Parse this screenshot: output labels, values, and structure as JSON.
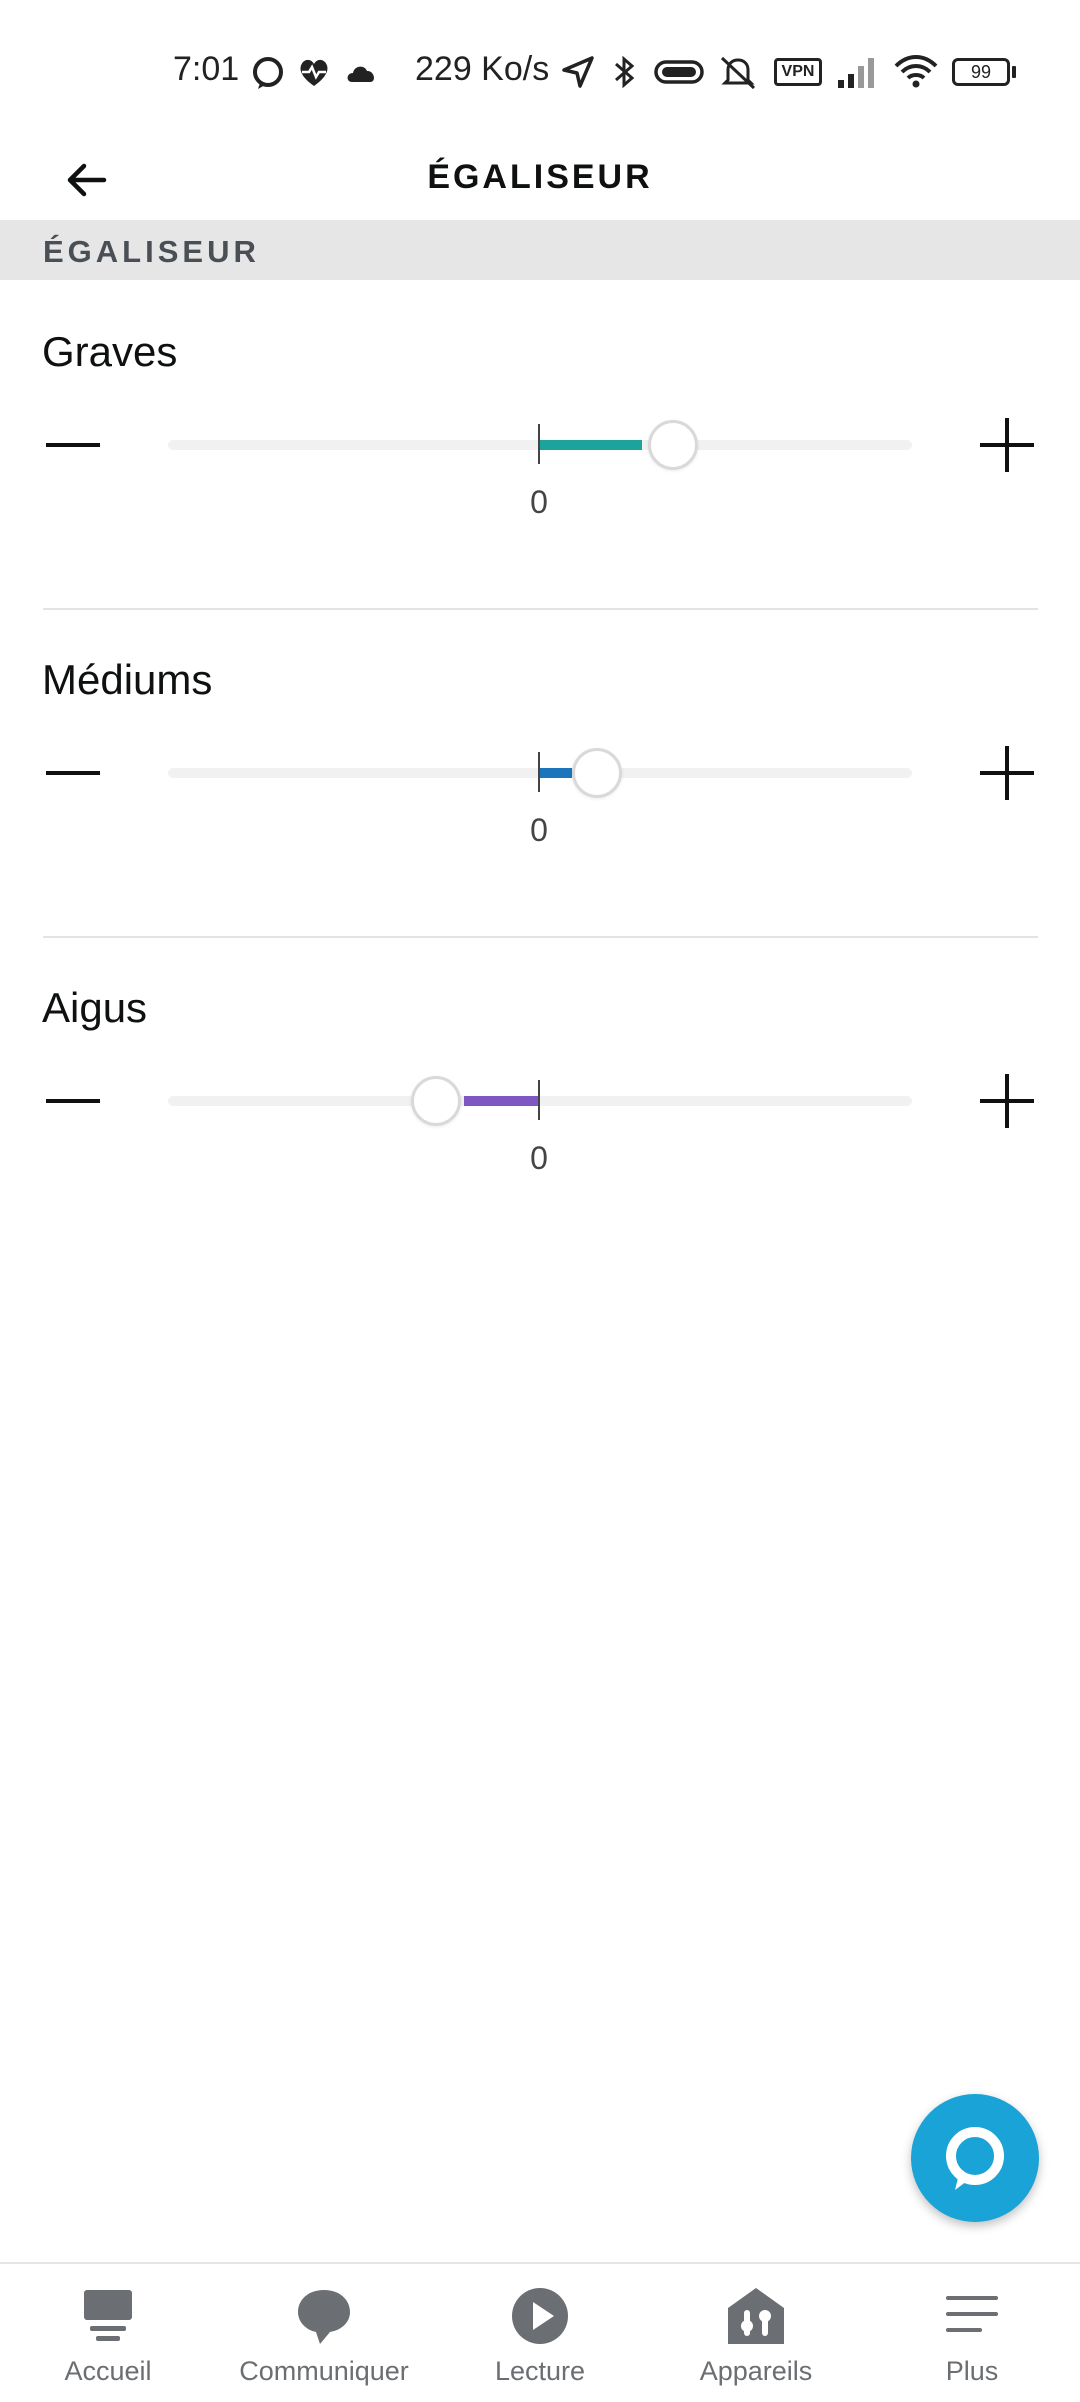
{
  "status_bar": {
    "time": "7:01",
    "speed": "229 Ko/s",
    "vpn": "VPN",
    "battery": "99"
  },
  "header": {
    "title": "ÉGALISEUR",
    "back_icon": "arrow-left-icon"
  },
  "section": {
    "label": "ÉGALISEUR"
  },
  "bands": [
    {
      "name": "Graves",
      "value": "0",
      "fill_color": "#1ba39c"
    },
    {
      "name": "Médiums",
      "value": "0",
      "fill_color": "#1b75bb"
    },
    {
      "name": "Aigus",
      "value": "0",
      "fill_color": "#7e57c2"
    }
  ],
  "colors": {
    "accent": "#1aa3d6",
    "track": "#f1f1f1",
    "section_bg": "#e6e6e6"
  },
  "bottom_nav": {
    "items": [
      {
        "label": "Accueil",
        "icon": "home-icon"
      },
      {
        "label": "Communiquer",
        "icon": "chat-bubble-icon"
      },
      {
        "label": "Lecture",
        "icon": "play-icon"
      },
      {
        "label": "Appareils",
        "icon": "devices-icon"
      },
      {
        "label": "Plus",
        "icon": "menu-icon"
      }
    ]
  }
}
